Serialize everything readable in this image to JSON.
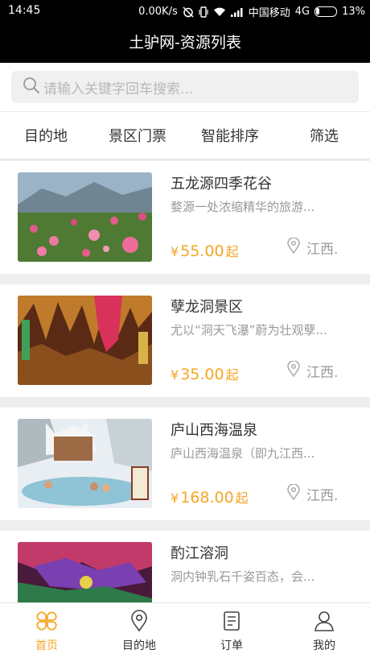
{
  "status": {
    "time": "14:45",
    "speed": "0.00K/s",
    "carrier": "中国移动",
    "network": "4G",
    "battery": "13%"
  },
  "header": {
    "title": "土驴网-资源列表"
  },
  "search": {
    "placeholder": "请输入关键字回车搜索..."
  },
  "filters": [
    "目的地",
    "景区门票",
    "智能排序",
    "筛选"
  ],
  "items": [
    {
      "name": "五龙源四季花谷",
      "desc": "婺源一处浓缩精华的旅游...",
      "price": "55.00",
      "currency": "¥",
      "suffix": "起",
      "location": "江西."
    },
    {
      "name": "孽龙洞景区",
      "desc": "尤以“洞天飞瀑”蔚为壮观孽...",
      "price": "35.00",
      "currency": "¥",
      "suffix": "起",
      "location": "江西."
    },
    {
      "name": "庐山西海温泉",
      "desc": "庐山西海温泉（即九江西...",
      "price": "168.00",
      "currency": "¥",
      "suffix": "起",
      "location": "江西."
    },
    {
      "name": "酌江溶洞",
      "desc": "洞内钟乳石千姿百态，会..."
    }
  ],
  "tabs": [
    {
      "label": "首页",
      "icon": "home-grid-icon",
      "active": true
    },
    {
      "label": "目的地",
      "icon": "location-pin-icon"
    },
    {
      "label": "订单",
      "icon": "order-doc-icon"
    },
    {
      "label": "我的",
      "icon": "user-icon"
    }
  ],
  "colors": {
    "accent": "#f5a623",
    "header_bg": "#000000",
    "page_bg": "#eeeeee",
    "text": "#333333",
    "muted": "#999999"
  }
}
